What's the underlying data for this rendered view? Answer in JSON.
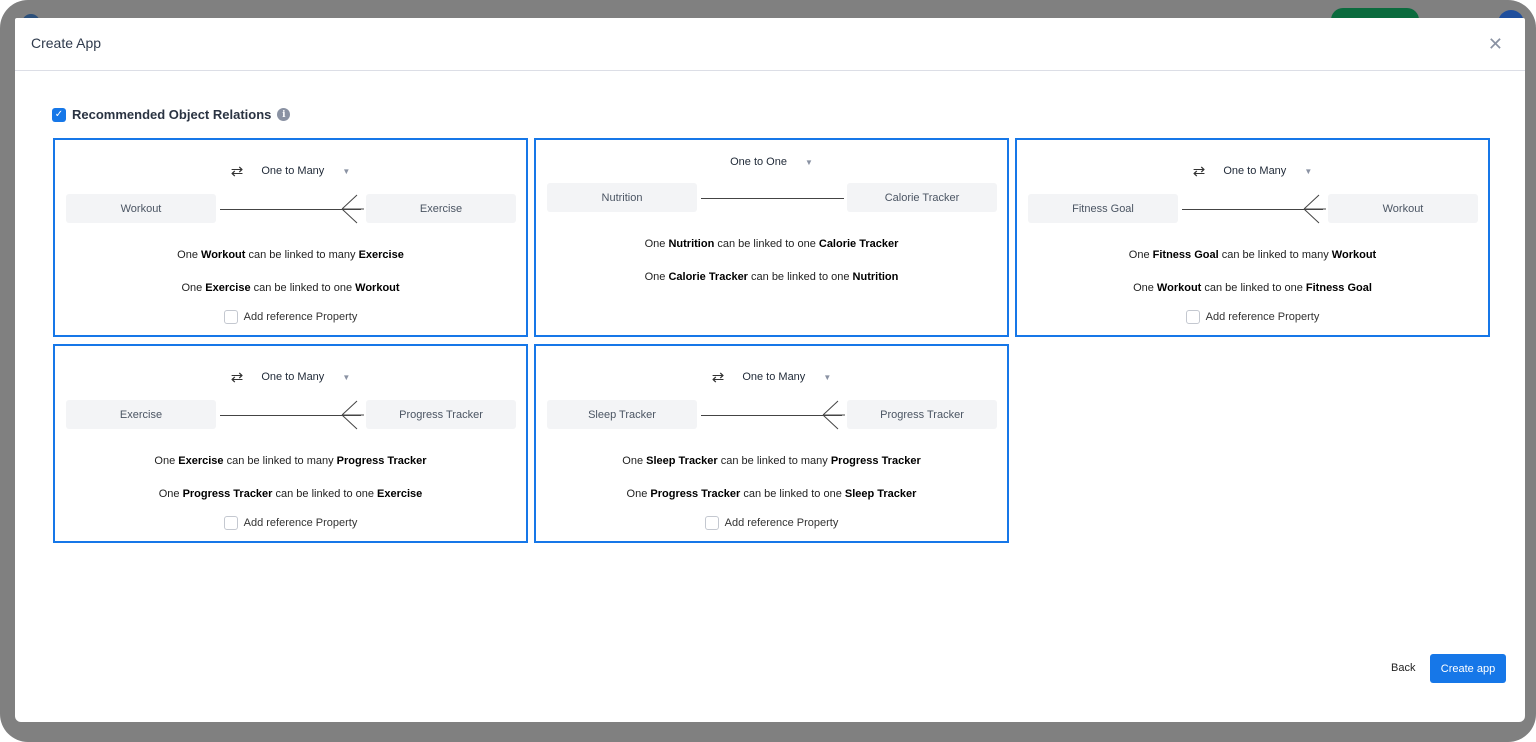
{
  "modal": {
    "title": "Create App",
    "close_icon": "close-icon"
  },
  "section": {
    "label": "Recommended Object Relations",
    "checked": true,
    "info_icon": "info-icon"
  },
  "accent": "#1677e8",
  "relations": [
    {
      "type": "One to Many",
      "left": "Workout",
      "right": "Exercise",
      "line1": [
        "One ",
        "Workout",
        " can be linked to many ",
        "Exercise"
      ],
      "line2": [
        "One ",
        "Exercise",
        " can be linked to one ",
        "Workout"
      ],
      "ref_label": "Add reference Property",
      "ref_checked": false
    },
    {
      "type": "One to One",
      "left": "Nutrition",
      "right": "Calorie Tracker",
      "line1": [
        "One ",
        "Nutrition",
        " can be linked to one ",
        "Calorie Tracker"
      ],
      "line2": [
        "One ",
        "Calorie Tracker",
        " can be linked to one ",
        "Nutrition"
      ]
    },
    {
      "type": "One to Many",
      "left": "Fitness Goal",
      "right": "Workout",
      "line1": [
        "One ",
        "Fitness Goal",
        " can be linked to many ",
        "Workout"
      ],
      "line2": [
        "One ",
        "Workout",
        " can be linked to one ",
        "Fitness Goal"
      ],
      "ref_label": "Add reference Property",
      "ref_checked": false
    },
    {
      "type": "One to Many",
      "left": "Exercise",
      "right": "Progress Tracker",
      "line1": [
        "One ",
        "Exercise",
        " can be linked to many ",
        "Progress Tracker"
      ],
      "line2": [
        "One ",
        "Progress Tracker",
        " can be linked to one ",
        "Exercise"
      ],
      "ref_label": "Add reference Property",
      "ref_checked": false
    },
    {
      "type": "One to Many",
      "left": "Sleep Tracker",
      "right": "Progress Tracker",
      "line1": [
        "One ",
        "Sleep Tracker",
        " can be linked to many ",
        "Progress Tracker"
      ],
      "line2": [
        "One ",
        "Progress Tracker",
        " can be linked to one ",
        "Sleep Tracker"
      ],
      "ref_label": "Add reference Property",
      "ref_checked": false
    }
  ],
  "footer": {
    "back": "Back",
    "create": "Create app"
  }
}
